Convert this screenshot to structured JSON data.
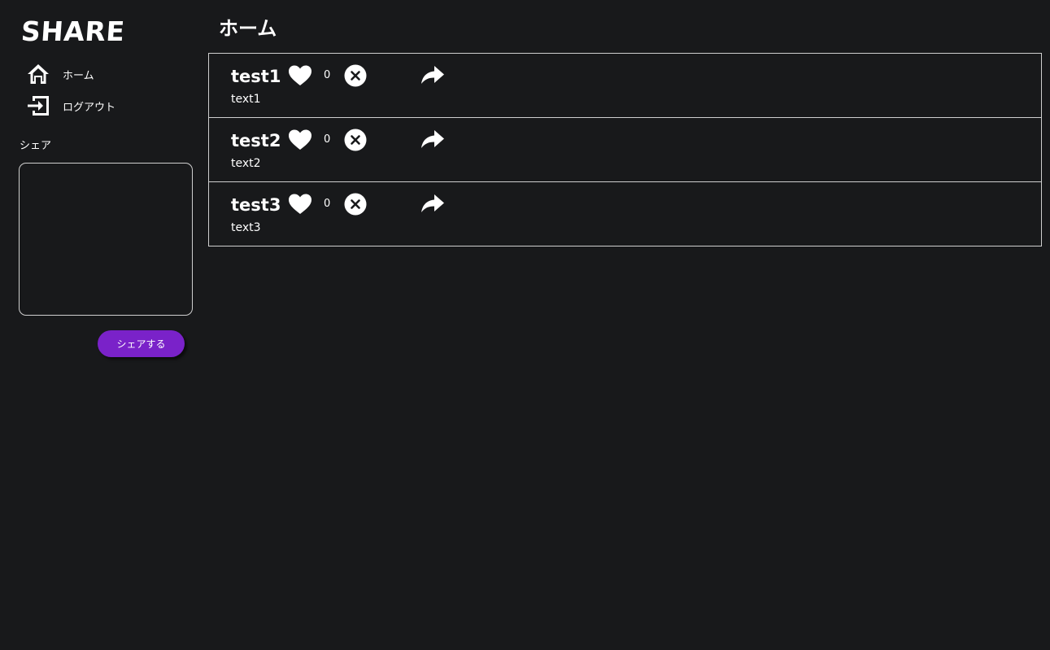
{
  "app": {
    "logo": "SHARE"
  },
  "sidebar": {
    "nav": [
      {
        "label": "ホーム",
        "icon": "home-icon"
      },
      {
        "label": "ログアウト",
        "icon": "logout-icon"
      }
    ],
    "share_label": "シェア",
    "textarea_value": "",
    "share_button_label": "シェアする"
  },
  "main": {
    "title": "ホーム",
    "posts": [
      {
        "title": "test1",
        "text": "text1",
        "likes": "0"
      },
      {
        "title": "test2",
        "text": "text2",
        "likes": "0"
      },
      {
        "title": "test3",
        "text": "text3",
        "likes": "0"
      }
    ]
  },
  "colors": {
    "background": "#18191b",
    "accent": "#7a22c9",
    "border": "#cfcfcf",
    "text": "#ffffff"
  }
}
